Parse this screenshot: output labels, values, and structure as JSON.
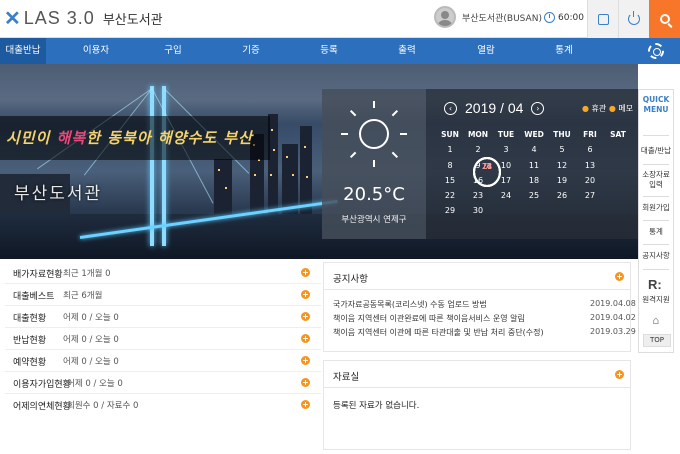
{
  "header": {
    "logo_text": "LAS 3.0",
    "library_name": "부산도서관",
    "user_name": "부산도서관(BUSAN)",
    "timer": "60:00"
  },
  "nav": [
    "대출반납",
    "이용자",
    "구입",
    "기증",
    "등록",
    "출력",
    "열람",
    "통계"
  ],
  "hero": {
    "slogan_a": "시민이 ",
    "slogan_b": "해복",
    "slogan_c": "한 동북아 해양수도 부산",
    "library_label": "부산도서관"
  },
  "weather": {
    "icon": "sun-icon",
    "temperature": "20.5°C",
    "location": "부산광역시 연제구"
  },
  "calendar": {
    "title": "2019 / 04",
    "legend_holiday": "휴관",
    "legend_memo": "메모",
    "weekdays": [
      "SUN",
      "MON",
      "TUE",
      "WED",
      "THU",
      "FRI",
      "SAT"
    ],
    "weeks": [
      [
        "",
        "1",
        "2",
        "3",
        "4",
        "5",
        "6"
      ],
      [
        "7",
        "8",
        "9",
        "10",
        "11",
        "12",
        "13"
      ],
      [
        "14",
        "15",
        "16",
        "17",
        "18",
        "19",
        "20"
      ],
      [
        "21",
        "22",
        "23",
        "24",
        "25",
        "26",
        "27"
      ],
      [
        "28",
        "29",
        "30",
        "",
        "",
        "",
        ""
      ]
    ]
  },
  "quick_menu": {
    "title": "QUICK MENU",
    "items": [
      "대출/반납",
      "소장자료 입력",
      "회원가입",
      "통계",
      "공지사항"
    ],
    "remote_support": "원격지원",
    "top": "TOP"
  },
  "stats": [
    {
      "label": "배가자료현황",
      "value": "최근 1개월 0"
    },
    {
      "label": "대출베스트",
      "value": "최근 6개월"
    },
    {
      "label": "대출현황",
      "value": "어제 0 / 오늘 0"
    },
    {
      "label": "반납현황",
      "value": "어제 0 / 오늘 0"
    },
    {
      "label": "예약현황",
      "value": "어제 0 / 오늘 0"
    },
    {
      "label": "이용자가입현황",
      "value": "어제 0 / 오늘 0"
    },
    {
      "label": "어제의연체현황",
      "value": "회원수 0 / 자료수 0"
    }
  ],
  "notice": {
    "title": "공지사항",
    "items": [
      {
        "text": "국가자료공동목록(코리스넷) 수동 업로드 방법",
        "date": "2019.04.08"
      },
      {
        "text": "책이음 지역센터 이관완료에 따른 책이음서비스 운영 알림",
        "date": "2019.04.02"
      },
      {
        "text": "책이음 지역센터 이관에 따른 타관대출 및 반납 처리 중단(수정)",
        "date": "2019.03.29"
      }
    ]
  },
  "data_room": {
    "title": "자료실",
    "empty_message": "등록된 자료가 없습니다."
  },
  "colors": {
    "brand_blue": "#2b6fbd",
    "accent_orange": "#f7762a",
    "plus_orange": "#f7941d"
  }
}
